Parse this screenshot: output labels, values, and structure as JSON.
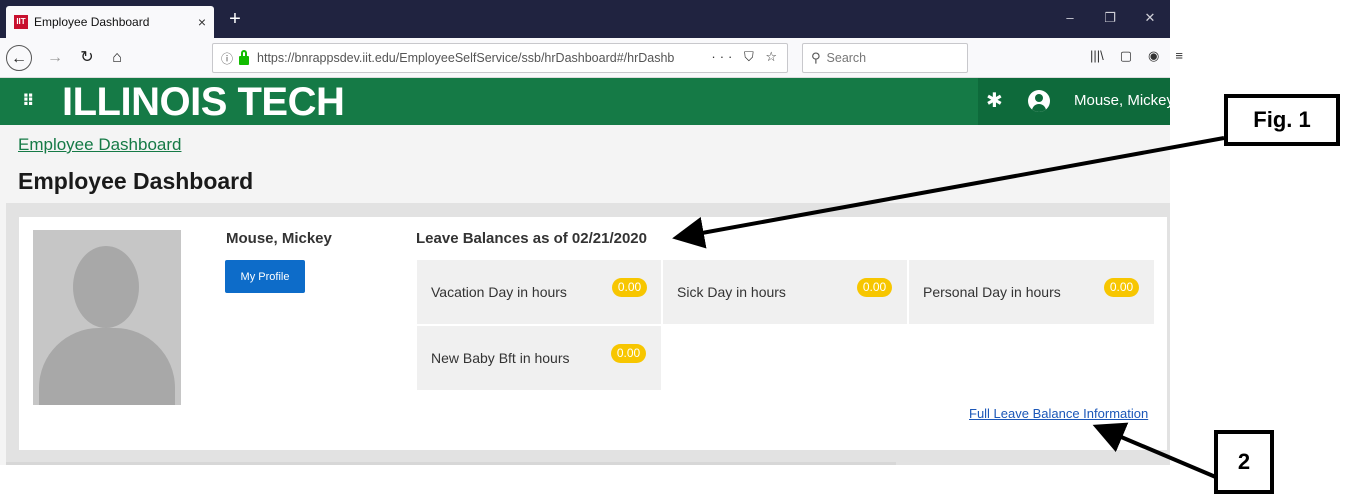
{
  "browser": {
    "tab_title": "Employee Dashboard",
    "tab_close": "×",
    "new_tab": "+",
    "url_info": "ⓘ",
    "url": "https://bnrappsdev.iit.edu/EmployeeSelfService/ssb/hrDashboard#/hrDashb",
    "url_actions": "··· ⛉ ☆",
    "search_placeholder": "Search",
    "toolbar_icons": [
      "|||\\",
      "▢",
      "◉",
      "≡"
    ],
    "win_controls": [
      "–",
      "❐",
      "✕"
    ]
  },
  "header": {
    "brand": "ILLINOIS TECH",
    "user_name": "Mouse, Mickey"
  },
  "page": {
    "breadcrumb": "Employee Dashboard",
    "title": "Employee Dashboard"
  },
  "profile": {
    "name": "Mouse, Mickey",
    "button_label": "My Profile"
  },
  "leave": {
    "heading": "Leave Balances as of 02/21/2020",
    "balances": [
      {
        "label": "Vacation Day in hours",
        "value": "0.00"
      },
      {
        "label": "Sick Day in hours",
        "value": "0.00"
      },
      {
        "label": "Personal Day in hours",
        "value": "0.00"
      },
      {
        "label": "New Baby Bft in hours",
        "value": "0.00"
      }
    ],
    "full_link": "Full Leave Balance Information"
  },
  "annotations": {
    "fig1": "Fig. 1",
    "fig2": "2"
  },
  "colors": {
    "brand_green": "#157a46",
    "badge_yellow": "#f7c600",
    "button_blue": "#0d6cc9"
  }
}
